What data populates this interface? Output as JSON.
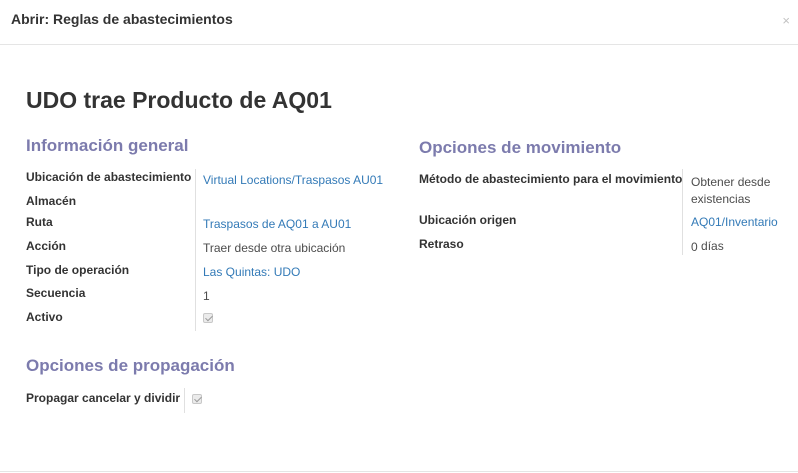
{
  "dialog": {
    "title": "Abrir: Reglas de abastecimientos",
    "close_symbol": "×"
  },
  "record": {
    "title": "UDO trae Producto de AQ01"
  },
  "general": {
    "section_title": "Información general",
    "ubicacion_label": "Ubicación de abastecimiento",
    "ubicacion_value": "Virtual Locations/Traspasos AU01",
    "almacen_label": "Almacén",
    "almacen_value": "",
    "ruta_label": "Ruta",
    "ruta_value": "Traspasos de AQ01 a AU01",
    "accion_label": "Acción",
    "accion_value": "Traer desde otra ubicación",
    "tipo_label": "Tipo de operación",
    "tipo_value": "Las Quintas: UDO",
    "secuencia_label": "Secuencia",
    "secuencia_value": "1",
    "activo_label": "Activo",
    "activo_checked": true
  },
  "movement": {
    "section_title": "Opciones de movimiento",
    "metodo_label": "Método de abastecimiento para el movimiento",
    "metodo_value_line1": "Obtener desde",
    "metodo_value_line2": "existencias",
    "origen_label": "Ubicación origen",
    "origen_value": "AQ01/Inventario",
    "retraso_label": "Retraso",
    "retraso_value": "0",
    "retraso_unit": "días"
  },
  "propagation": {
    "section_title": "Opciones de propagación",
    "propagar_label": "Propagar cancelar y dividir",
    "propagar_checked": true
  }
}
